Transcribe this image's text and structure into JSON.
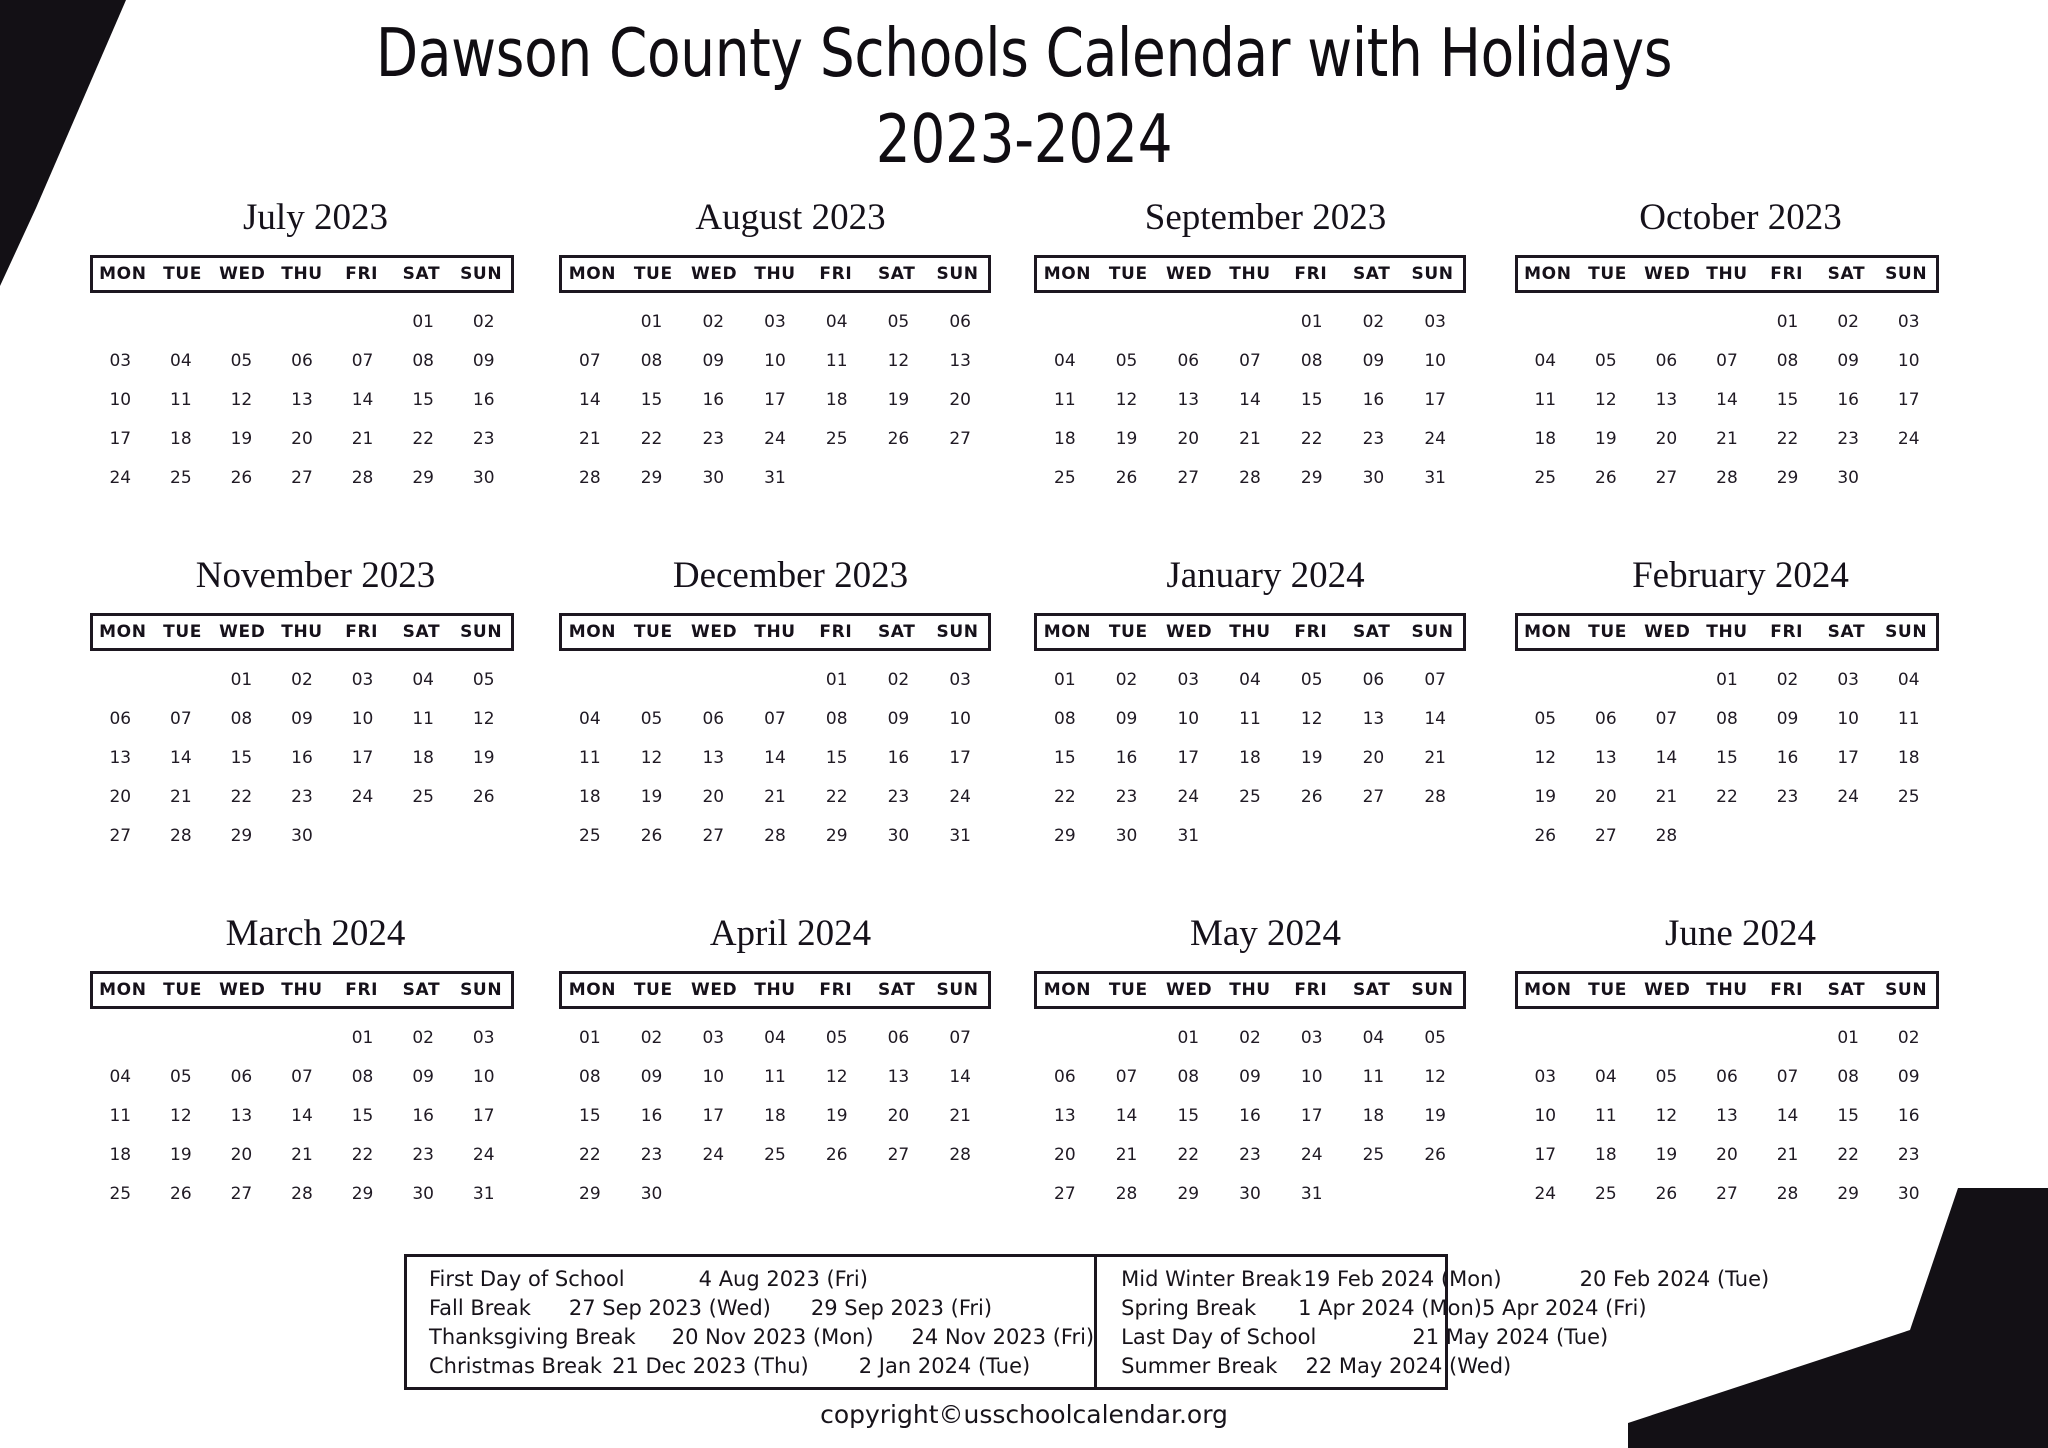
{
  "header": {
    "title_line1": "Dawson County Schools Calendar with Holidays",
    "title_line2": "2023-2024"
  },
  "weekday_headers": [
    "MON",
    "TUE",
    "WED",
    "THU",
    "FRI",
    "SAT",
    "SUN"
  ],
  "months": [
    {
      "name": "July 2023",
      "lead_blanks": 5,
      "days": [
        "01",
        "02",
        "03",
        "04",
        "05",
        "06",
        "07",
        "08",
        "09",
        "10",
        "11",
        "12",
        "13",
        "14",
        "15",
        "16",
        "17",
        "18",
        "19",
        "20",
        "21",
        "22",
        "23",
        "24",
        "25",
        "26",
        "27",
        "28",
        "29",
        "30"
      ]
    },
    {
      "name": "August 2023",
      "lead_blanks": 1,
      "days": [
        "01",
        "02",
        "03",
        "04",
        "05",
        "06",
        "07",
        "08",
        "09",
        "10",
        "11",
        "12",
        "13",
        "14",
        "15",
        "16",
        "17",
        "18",
        "19",
        "20",
        "21",
        "22",
        "23",
        "24",
        "25",
        "26",
        "27",
        "28",
        "29",
        "30",
        "31"
      ]
    },
    {
      "name": "September 2023",
      "lead_blanks": 4,
      "days": [
        "01",
        "02",
        "03",
        "04",
        "05",
        "06",
        "07",
        "08",
        "09",
        "10",
        "11",
        "12",
        "13",
        "14",
        "15",
        "16",
        "17",
        "18",
        "19",
        "20",
        "21",
        "22",
        "23",
        "24",
        "25",
        "26",
        "27",
        "28",
        "29",
        "30",
        "31"
      ]
    },
    {
      "name": "October 2023",
      "lead_blanks": 4,
      "days": [
        "01",
        "02",
        "03",
        "04",
        "05",
        "06",
        "07",
        "08",
        "09",
        "10",
        "11",
        "12",
        "13",
        "14",
        "15",
        "16",
        "17",
        "18",
        "19",
        "20",
        "21",
        "22",
        "23",
        "24",
        "25",
        "26",
        "27",
        "28",
        "29",
        "30"
      ]
    },
    {
      "name": "November 2023",
      "lead_blanks": 2,
      "days": [
        "01",
        "02",
        "03",
        "04",
        "05",
        "06",
        "07",
        "08",
        "09",
        "10",
        "11",
        "12",
        "13",
        "14",
        "15",
        "16",
        "17",
        "18",
        "19",
        "20",
        "21",
        "22",
        "23",
        "24",
        "25",
        "26",
        "27",
        "28",
        "29",
        "30"
      ]
    },
    {
      "name": "December 2023",
      "lead_blanks": 4,
      "days": [
        "01",
        "02",
        "03",
        "04",
        "05",
        "06",
        "07",
        "08",
        "09",
        "10",
        "11",
        "12",
        "13",
        "14",
        "15",
        "16",
        "17",
        "18",
        "19",
        "20",
        "21",
        "22",
        "23",
        "24",
        "25",
        "26",
        "27",
        "28",
        "29",
        "30",
        "31"
      ]
    },
    {
      "name": "January 2024",
      "lead_blanks": 0,
      "days": [
        "01",
        "02",
        "03",
        "04",
        "05",
        "06",
        "07",
        "08",
        "09",
        "10",
        "11",
        "12",
        "13",
        "14",
        "15",
        "16",
        "17",
        "18",
        "19",
        "20",
        "21",
        "22",
        "23",
        "24",
        "25",
        "26",
        "27",
        "28",
        "29",
        "30",
        "31"
      ]
    },
    {
      "name": "February 2024",
      "lead_blanks": 3,
      "days": [
        "01",
        "02",
        "03",
        "04",
        "05",
        "06",
        "07",
        "08",
        "09",
        "10",
        "11",
        "12",
        "13",
        "14",
        "15",
        "16",
        "17",
        "18",
        "19",
        "20",
        "21",
        "22",
        "23",
        "24",
        "25",
        "26",
        "27",
        "28"
      ]
    },
    {
      "name": "March 2024",
      "lead_blanks": 4,
      "days": [
        "01",
        "02",
        "03",
        "04",
        "05",
        "06",
        "07",
        "08",
        "09",
        "10",
        "11",
        "12",
        "13",
        "14",
        "15",
        "16",
        "17",
        "18",
        "19",
        "20",
        "21",
        "22",
        "23",
        "24",
        "25",
        "26",
        "27",
        "28",
        "29",
        "30",
        "31"
      ]
    },
    {
      "name": "April 2024",
      "lead_blanks": 0,
      "days": [
        "01",
        "02",
        "03",
        "04",
        "05",
        "06",
        "07",
        "08",
        "09",
        "10",
        "11",
        "12",
        "13",
        "14",
        "15",
        "16",
        "17",
        "18",
        "19",
        "20",
        "21",
        "22",
        "23",
        "24",
        "25",
        "26",
        "27",
        "28",
        "29",
        "30"
      ]
    },
    {
      "name": "May 2024",
      "lead_blanks": 2,
      "days": [
        "01",
        "02",
        "03",
        "04",
        "05",
        "06",
        "07",
        "08",
        "09",
        "10",
        "11",
        "12",
        "13",
        "14",
        "15",
        "16",
        "17",
        "18",
        "19",
        "20",
        "21",
        "22",
        "23",
        "24",
        "25",
        "26",
        "27",
        "28",
        "29",
        "30",
        "31"
      ]
    },
    {
      "name": "June 2024",
      "lead_blanks": 5,
      "days": [
        "01",
        "02",
        "03",
        "04",
        "05",
        "06",
        "07",
        "08",
        "09",
        "10",
        "11",
        "12",
        "13",
        "14",
        "15",
        "16",
        "17",
        "18",
        "19",
        "20",
        "21",
        "22",
        "23",
        "24",
        "25",
        "26",
        "27",
        "28",
        "29",
        "30"
      ]
    }
  ],
  "legend": {
    "left": [
      {
        "label": "First Day of School",
        "start": "4 Aug 2023 (Fri)",
        "end": ""
      },
      {
        "label": "Fall Break",
        "start": "27 Sep 2023 (Wed)",
        "end": "29 Sep 2023 (Fri)"
      },
      {
        "label": "Thanksgiving Break",
        "start": "20 Nov 2023 (Mon)",
        "end": "24 Nov 2023 (Fri)"
      },
      {
        "label": "Christmas Break",
        "start": "21 Dec 2023 (Thu)",
        "end": "2 Jan 2024 (Tue)"
      }
    ],
    "right": [
      {
        "label": "Mid Winter Break",
        "start": "19 Feb 2024 (Mon)",
        "end": "20 Feb 2024 (Tue)"
      },
      {
        "label": "Spring Break",
        "start": "1 Apr 2024 (Mon)",
        "end": "5 Apr 2024 (Fri)"
      },
      {
        "label": "Last Day of School",
        "start": "21 May 2024 (Tue)",
        "end": ""
      },
      {
        "label": "Summer Break",
        "start": "22 May 2024  (Wed)",
        "end": ""
      }
    ]
  },
  "footer": {
    "copyright": "copyright©usschoolcalendar.org"
  },
  "colors": {
    "ink": "#17131a",
    "accent_black": "#131015",
    "paper": "#ffffff"
  }
}
